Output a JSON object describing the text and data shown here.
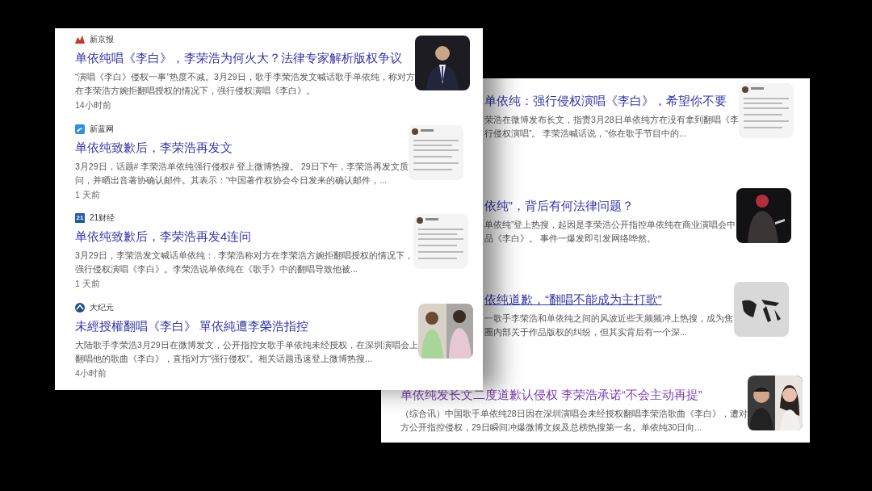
{
  "front_results": [
    {
      "source": "新京报",
      "title": "单依纯唱《李白》，李荣浩为何火大？法律专家解析版权争议",
      "snippet_lines": [
        "“演唱《李白》侵权一事”热度不减。3月29日，歌手李荣浩发文喊话歌手单依纯，称对方",
        "在李荣浩方婉拒翻唱授权的情况下，强行侵权演唱《李白》。"
      ],
      "time": "14小时前"
    },
    {
      "source": "新蓝网",
      "title": "单依纯致歉后，李荣浩再发文",
      "snippet_lines": [
        "3月29日，话题# 李荣浩单依纯强行侵权# 登上微博热搜。 29日下午，李荣浩再发文质",
        "问，并晒出音著协确认邮件。其表示：“中国著作权协会今日发来的确认邮件，..."
      ],
      "time": "1 天前"
    },
    {
      "source": "21财经",
      "logo_text": "21",
      "title": "单依纯致歉后，李荣浩再发4连问",
      "snippet_lines": [
        "3月29日，李荣浩发文喊话单依纯：. 李荣浩称对方在李荣浩方婉拒翻唱授权的情况下，",
        "强行侵权演唱《李白》。李荣浩说单依纯在《歌手》中的翻唱导致他被..."
      ],
      "time": "1 天前"
    },
    {
      "source": "大纪元",
      "title": "未經授權翻唱《李白》 單依純遭李榮浩指控",
      "snippet_lines": [
        "大陆歌手李荣浩3月29日在微博发文，公开指控女歌手单依纯未经授权，在深圳演唱会上",
        "翻唱他的歌曲《李白》，直指对方“强行侵权”。相关话题迅速登上微博热搜..."
      ],
      "time": "4小时前"
    }
  ],
  "back_results": [
    {
      "title": "单依纯：强行侵权演唱《李白》，希望你不要",
      "snippet_lines": [
        "荣浩在微博发布长文，指责3月28日单依纯方在没有拿到翻唱《李",
        "行侵权演唱”。 李荣浩喊话说，“你在歌手节目中的..."
      ],
      "underlined": false,
      "visited": false
    },
    {
      "title": "依纯”，背后有何法律问题？",
      "snippet_lines": [
        "单依纯”登上热搜，起因是李荣浩公开指控单依纯在商业演唱会中",
        "品《李白》。 事件一爆发即引发网络哗然。"
      ],
      "underlined": false,
      "visited": false
    },
    {
      "title": "依纯道歉，“翻唱不能成为主打歌”",
      "snippet_lines": [
        "一歌手李荣浩和单依纯之间的风波近些天频频冲上热搜，成为焦",
        "圈内部关于作品版权的纠纷，但其实背后有一个深..."
      ],
      "underlined": true,
      "visited": false
    },
    {
      "title": "单依纯发长文二度道歉认侵权 李荣浩承诺“不会主动再提”",
      "snippet_lines": [
        "（综合讯）中国歌手单依纯28日因在深圳演唱会未经授权翻唱李荣浩歌曲《李白》，遭对",
        "方公开指控侵权，29日瞬间冲爆微博文娱及总榜热搜第一名。单依纯30日向..."
      ],
      "underlined": false,
      "visited": true
    }
  ]
}
